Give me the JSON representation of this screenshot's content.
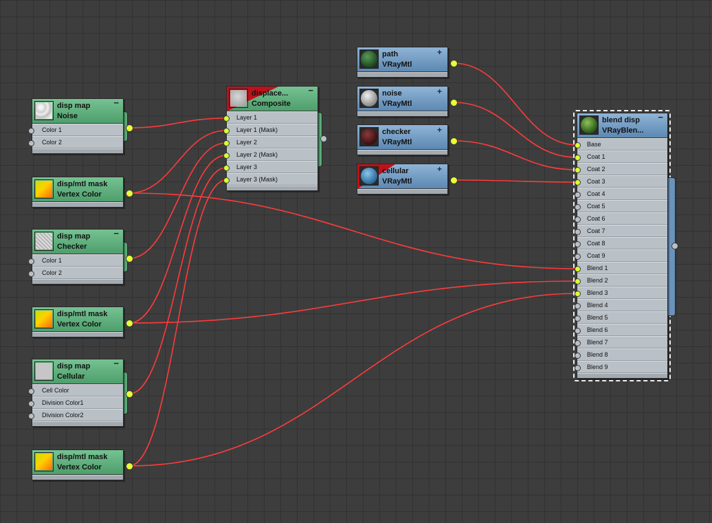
{
  "colors": {
    "wire": "#ff3b3b",
    "socket": "#d8ff33",
    "map_header": "#5aab79",
    "mtl_header": "#6a93bb"
  },
  "nodes": {
    "disp_noise": {
      "title": "disp map",
      "type": "Noise",
      "slots": [
        "Color 1",
        "Color 2"
      ],
      "icon": "noise-texture-thumb"
    },
    "mask1": {
      "title": "disp/mtl mask",
      "type": "Vertex Color",
      "icon": "gradient-thumb"
    },
    "disp_checker": {
      "title": "disp map",
      "type": "Checker",
      "slots": [
        "Color 1",
        "Color 2"
      ],
      "icon": "checker-texture-thumb"
    },
    "mask2": {
      "title": "disp/mtl mask",
      "type": "Vertex Color",
      "icon": "gradient-thumb"
    },
    "disp_cellular": {
      "title": "disp map",
      "type": "Cellular",
      "slots": [
        "Cell Color",
        "Division Color1",
        "Division Color2"
      ],
      "icon": "cellular-texture-thumb"
    },
    "mask3": {
      "title": "disp/mtl mask",
      "type": "Vertex Color",
      "icon": "gradient-thumb"
    },
    "composite": {
      "title": "displace...",
      "type": "Composite",
      "slots": [
        "Layer 1",
        "Layer 1 (Mask)",
        "Layer 2",
        "Layer 2 (Mask)",
        "Layer 3",
        "Layer 3 (Mask)"
      ],
      "icon": "composite-thumb"
    },
    "path": {
      "title": "path",
      "type": "VRayMtl",
      "icon": "green-sphere"
    },
    "noise": {
      "title": "noise",
      "type": "VRayMtl",
      "icon": "grey-sphere"
    },
    "checker": {
      "title": "checker",
      "type": "VRayMtl",
      "icon": "maroon-sphere"
    },
    "cellular": {
      "title": "cellular",
      "type": "VRayMtl",
      "icon": "blue-sphere"
    },
    "blend": {
      "title": "blend disp",
      "type": "VRayBlen...",
      "slots": [
        "Base",
        "Coat 1",
        "Coat 2",
        "Coat 3",
        "Coat 4",
        "Coat 5",
        "Coat 6",
        "Coat 7",
        "Coat 8",
        "Coat 9",
        "Blend 1",
        "Blend 2",
        "Blend 3",
        "Blend 4",
        "Blend 5",
        "Blend 6",
        "Blend 7",
        "Blend 8",
        "Blend 9"
      ],
      "icon": "green-sphere"
    }
  },
  "connections": [
    {
      "from": "disp_noise",
      "to": "composite",
      "slot": "Layer 1"
    },
    {
      "from": "mask1",
      "to": "composite",
      "slot": "Layer 1 (Mask)"
    },
    {
      "from": "disp_checker",
      "to": "composite",
      "slot": "Layer 2"
    },
    {
      "from": "mask2",
      "to": "composite",
      "slot": "Layer 2 (Mask)"
    },
    {
      "from": "disp_cellular",
      "to": "composite",
      "slot": "Layer 3"
    },
    {
      "from": "mask3",
      "to": "composite",
      "slot": "Layer 3 (Mask)"
    },
    {
      "from": "path",
      "to": "blend",
      "slot": "Base"
    },
    {
      "from": "noise",
      "to": "blend",
      "slot": "Coat 1"
    },
    {
      "from": "checker",
      "to": "blend",
      "slot": "Coat 2"
    },
    {
      "from": "cellular",
      "to": "blend",
      "slot": "Coat 3"
    },
    {
      "from": "mask1",
      "to": "blend",
      "slot": "Blend 1"
    },
    {
      "from": "mask2",
      "to": "blend",
      "slot": "Blend 2"
    },
    {
      "from": "mask3",
      "to": "blend",
      "slot": "Blend 3"
    }
  ]
}
